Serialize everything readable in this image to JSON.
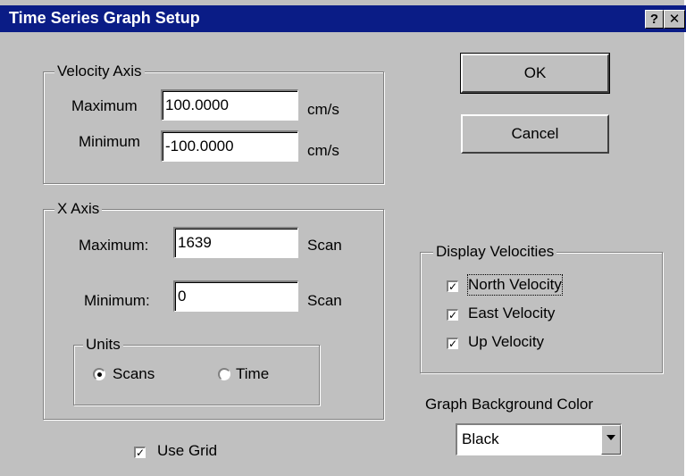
{
  "window": {
    "title": "Time Series Graph Setup",
    "help_label": "?",
    "close_label": "✕"
  },
  "velocity_axis": {
    "legend": "Velocity Axis",
    "max_label": "Maximum",
    "max_value": "100.0000",
    "max_unit": "cm/s",
    "min_label": "Minimum",
    "min_value": "-100.0000",
    "min_unit": "cm/s"
  },
  "x_axis": {
    "legend": "X Axis",
    "max_label": "Maximum:",
    "max_value": "1639",
    "max_unit": "Scan",
    "min_label": "Minimum:",
    "min_value": "0",
    "min_unit": "Scan",
    "units": {
      "legend": "Units",
      "options": [
        "Scans",
        "Time"
      ],
      "selected": "Scans"
    }
  },
  "use_grid": {
    "label": "Use Grid",
    "checked": true
  },
  "buttons": {
    "ok": "OK",
    "cancel": "Cancel"
  },
  "display_velocities": {
    "legend": "Display Velocities",
    "north": {
      "label": "North Velocity",
      "checked": true
    },
    "east": {
      "label": "East Velocity",
      "checked": true
    },
    "up": {
      "label": "Up Velocity",
      "checked": true
    }
  },
  "background_color": {
    "label": "Graph Background Color",
    "selected": "Black"
  },
  "colors": {
    "titlebar": "#0a1c86",
    "face": "#c0c0c0"
  }
}
